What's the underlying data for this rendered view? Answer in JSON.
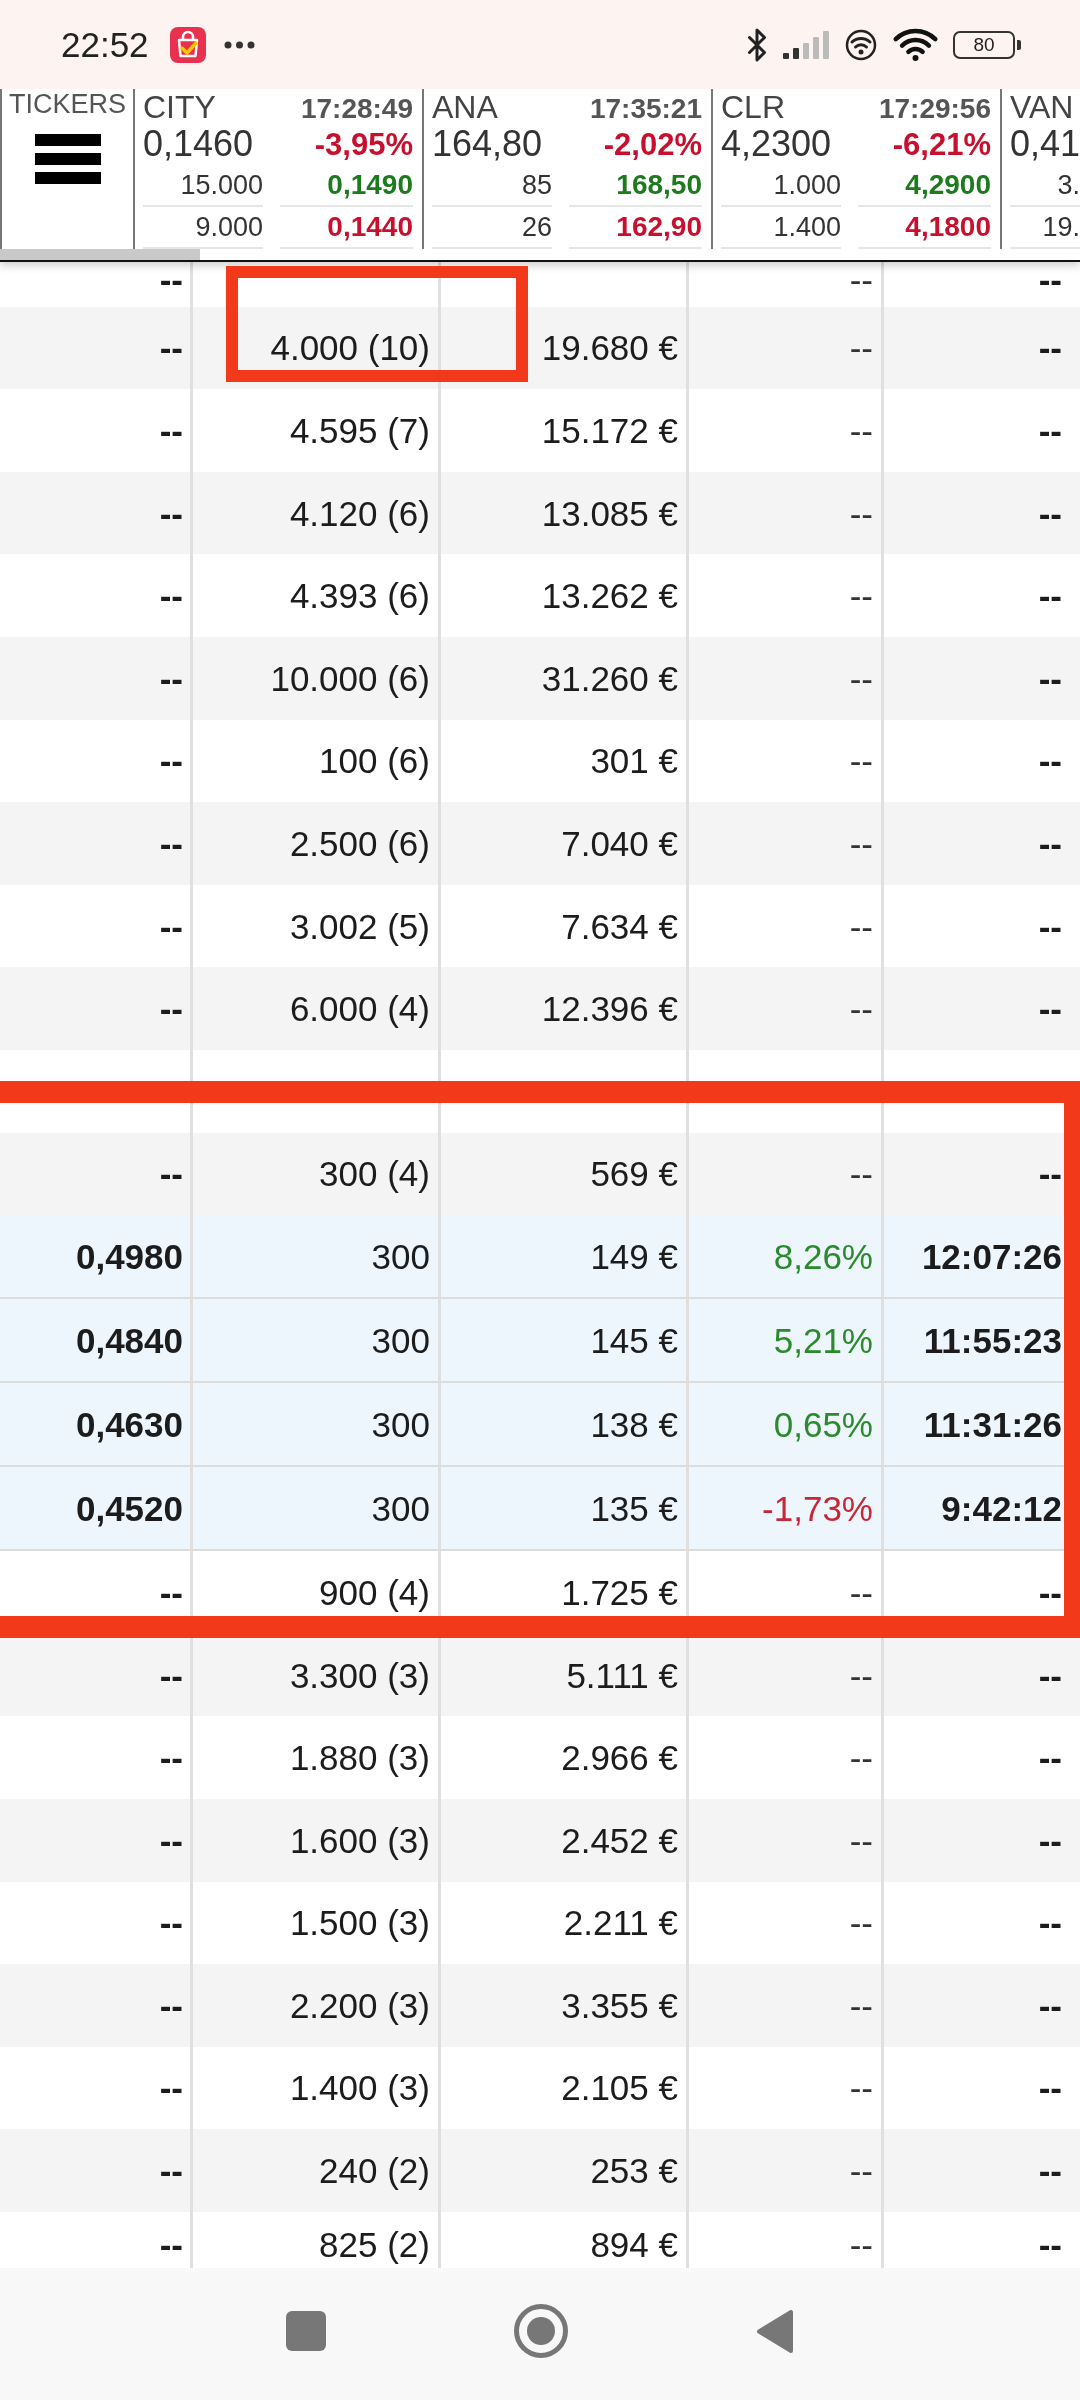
{
  "status_bar": {
    "time": "22:52",
    "battery": "80"
  },
  "tickers": {
    "label": "TICKERS",
    "cards": [
      {
        "name": "CITY",
        "time": "17:28:49",
        "price": "0,1460",
        "change": "-3,95%",
        "positive": false,
        "bid": {
          "size": "15.000",
          "price": "0,1490"
        },
        "ask": {
          "size": "9.000",
          "price": "0,1440"
        }
      },
      {
        "name": "ANA",
        "time": "17:35:21",
        "price": "164,80",
        "change": "-2,02%",
        "positive": false,
        "bid": {
          "size": "85",
          "price": "168,50"
        },
        "ask": {
          "size": "26",
          "price": "162,90"
        }
      },
      {
        "name": "CLR",
        "time": "17:29:56",
        "price": "4,2300",
        "change": "-6,21%",
        "positive": false,
        "bid": {
          "size": "1.000",
          "price": "4,2900"
        },
        "ask": {
          "size": "1.400",
          "price": "4,1800"
        }
      },
      {
        "name": "VAN",
        "price": "0,41",
        "bid": {
          "size": "3."
        },
        "ask": {
          "size": "19."
        }
      }
    ]
  },
  "table": {
    "rows": [
      {
        "kind": "data",
        "highlighted": false,
        "column_1": "--",
        "column_4": "--",
        "column_5": "--"
      },
      {
        "kind": "data",
        "highlighted": false,
        "column_1": "--",
        "column_2": "4.000 (10)",
        "column_3": "19.680 €",
        "column_4": "--",
        "column_5": "--"
      },
      {
        "kind": "data",
        "highlighted": false,
        "column_1": "--",
        "column_2": "4.595 (7)",
        "column_3": "15.172 €",
        "column_4": "--",
        "column_5": "--"
      },
      {
        "kind": "data",
        "highlighted": false,
        "column_1": "--",
        "column_2": "4.120 (6)",
        "column_3": "13.085 €",
        "column_4": "--",
        "column_5": "--"
      },
      {
        "kind": "data",
        "highlighted": false,
        "column_1": "--",
        "column_2": "4.393 (6)",
        "column_3": "13.262 €",
        "column_4": "--",
        "column_5": "--"
      },
      {
        "kind": "data",
        "highlighted": false,
        "column_1": "--",
        "column_2": "10.000 (6)",
        "column_3": "31.260 €",
        "column_4": "--",
        "column_5": "--"
      },
      {
        "kind": "data",
        "highlighted": false,
        "column_1": "--",
        "column_2": "100 (6)",
        "column_3": "301 €",
        "column_4": "--",
        "column_5": "--"
      },
      {
        "kind": "data",
        "highlighted": false,
        "column_1": "--",
        "column_2": "2.500 (6)",
        "column_3": "7.040 €",
        "column_4": "--",
        "column_5": "--"
      },
      {
        "kind": "data",
        "highlighted": false,
        "column_1": "--",
        "column_2": "3.002 (5)",
        "column_3": "7.634 €",
        "column_4": "--",
        "column_5": "--"
      },
      {
        "kind": "data",
        "highlighted": false,
        "column_1": "--",
        "column_2": "6.000 (4)",
        "column_3": "12.396 €",
        "column_4": "--",
        "column_5": "--"
      },
      {
        "kind": "blank",
        "highlighted": false
      },
      {
        "kind": "data",
        "highlighted": false,
        "column_1": "--",
        "column_2": "300 (4)",
        "column_3": "569 €",
        "column_4": "--",
        "column_5": "--"
      },
      {
        "kind": "data",
        "highlighted": true,
        "column_1": "0,4980",
        "column_2": "300",
        "column_3": "149 €",
        "column_4": "8,26%",
        "positive": true,
        "column_5": "12:07:26"
      },
      {
        "kind": "data",
        "highlighted": true,
        "column_1": "0,4840",
        "column_2": "300",
        "column_3": "145 €",
        "column_4": "5,21%",
        "positive": true,
        "column_5": "11:55:23"
      },
      {
        "kind": "data",
        "highlighted": true,
        "column_1": "0,4630",
        "column_2": "300",
        "column_3": "138 €",
        "column_4": "0,65%",
        "positive": true,
        "column_5": "11:31:26"
      },
      {
        "kind": "data",
        "highlighted": true,
        "column_1": "0,4520",
        "column_2": "300",
        "column_3": "135 €",
        "column_4": "-1,73%",
        "positive": false,
        "column_5": "9:42:12"
      },
      {
        "kind": "data",
        "highlighted": false,
        "column_1": "--",
        "column_2": "900 (4)",
        "column_3": "1.725 €",
        "column_4": "--",
        "column_5": "--"
      },
      {
        "kind": "data",
        "highlighted": false,
        "column_1": "--",
        "column_2": "3.300 (3)",
        "column_3": "5.111 €",
        "column_4": "--",
        "column_5": "--"
      },
      {
        "kind": "data",
        "highlighted": false,
        "column_1": "--",
        "column_2": "1.880 (3)",
        "column_3": "2.966 €",
        "column_4": "--",
        "column_5": "--"
      },
      {
        "kind": "data",
        "highlighted": false,
        "column_1": "--",
        "column_2": "1.600 (3)",
        "column_3": "2.452 €",
        "column_4": "--",
        "column_5": "--"
      },
      {
        "kind": "data",
        "highlighted": false,
        "column_1": "--",
        "column_2": "1.500 (3)",
        "column_3": "2.211 €",
        "column_4": "--",
        "column_5": "--"
      },
      {
        "kind": "data",
        "highlighted": false,
        "column_1": "--",
        "column_2": "2.200 (3)",
        "column_3": "3.355 €",
        "column_4": "--",
        "column_5": "--"
      },
      {
        "kind": "data",
        "highlighted": false,
        "column_1": "--",
        "column_2": "1.400 (3)",
        "column_3": "2.105 €",
        "column_4": "--",
        "column_5": "--"
      },
      {
        "kind": "data",
        "highlighted": false,
        "column_1": "--",
        "column_2": "240 (2)",
        "column_3": "253 €",
        "column_4": "--",
        "column_5": "--"
      },
      {
        "kind": "data",
        "highlighted": false,
        "column_1": "--",
        "column_2": "825 (2)",
        "column_3": "894 €",
        "column_4": "--",
        "column_5": "--"
      }
    ]
  },
  "annotations": [
    {
      "kind": "rectangle"
    },
    {
      "kind": "rectangle"
    }
  ]
}
